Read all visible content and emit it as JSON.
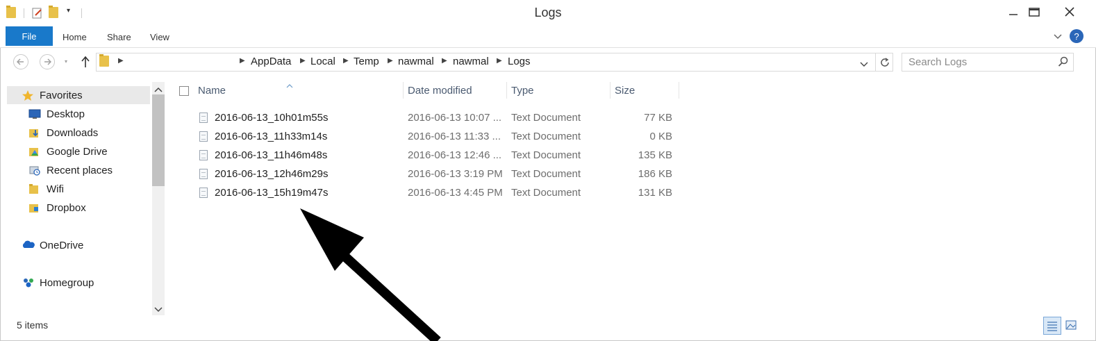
{
  "window": {
    "title": "Logs"
  },
  "ribbon": {
    "file": "File",
    "tabs": [
      "Home",
      "Share",
      "View"
    ]
  },
  "address": {
    "crumbs": [
      "AppData",
      "Local",
      "Temp",
      "nawmal",
      "nawmal",
      "Logs"
    ]
  },
  "search": {
    "placeholder": "Search Logs"
  },
  "navpane": {
    "favorites": "Favorites",
    "items": [
      {
        "label": "Desktop",
        "icon": "desktop-icon"
      },
      {
        "label": "Downloads",
        "icon": "downloads-folder-icon"
      },
      {
        "label": "Google Drive",
        "icon": "google-drive-icon"
      },
      {
        "label": "Recent places",
        "icon": "recent-places-icon"
      },
      {
        "label": "Wifi",
        "icon": "folder-icon"
      },
      {
        "label": "Dropbox",
        "icon": "dropbox-folder-icon"
      }
    ],
    "onedrive": "OneDrive",
    "homegroup": "Homegroup"
  },
  "columns": {
    "name": "Name",
    "date": "Date modified",
    "type": "Type",
    "size": "Size"
  },
  "files": [
    {
      "name": "2016-06-13_10h01m55s",
      "date": "2016-06-13 10:07 ...",
      "type": "Text Document",
      "size": "77 KB"
    },
    {
      "name": "2016-06-13_11h33m14s",
      "date": "2016-06-13 11:33 ...",
      "type": "Text Document",
      "size": "0 KB"
    },
    {
      "name": "2016-06-13_11h46m48s",
      "date": "2016-06-13 12:46 ...",
      "type": "Text Document",
      "size": "135 KB"
    },
    {
      "name": "2016-06-13_12h46m29s",
      "date": "2016-06-13 3:19 PM",
      "type": "Text Document",
      "size": "186 KB"
    },
    {
      "name": "2016-06-13_15h19m47s",
      "date": "2016-06-13 4:45 PM",
      "type": "Text Document",
      "size": "131 KB"
    }
  ],
  "status": {
    "count": "5 items"
  },
  "colors": {
    "accent": "#1979ca",
    "folder": "#e8c14a"
  }
}
